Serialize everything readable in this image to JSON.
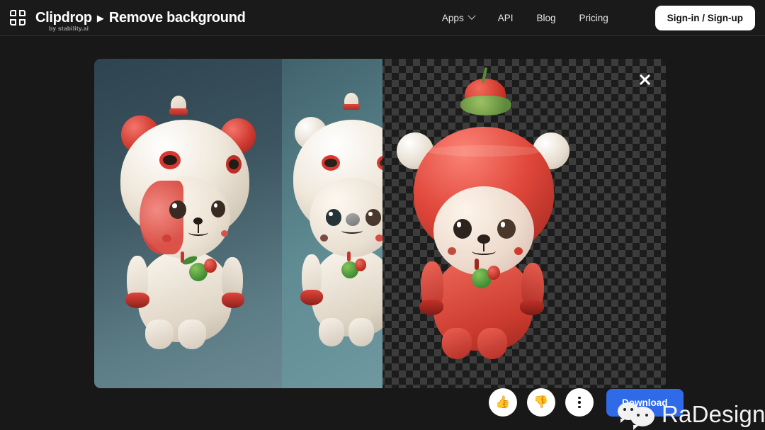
{
  "header": {
    "logo_icon": "crop-frame-icon",
    "brand_name": "Clipdrop",
    "brand_separator": "▶",
    "tool_name": "Remove background",
    "brand_subtitle": "by stability.ai",
    "nav": [
      {
        "label": "Apps",
        "has_chevron": true,
        "icon": "chevron-down-icon"
      },
      {
        "label": "API",
        "has_chevron": false
      },
      {
        "label": "Blog",
        "has_chevron": false
      },
      {
        "label": "Pricing",
        "has_chevron": false
      }
    ],
    "signin_label": "Sign-in / Sign-up"
  },
  "viewer": {
    "close_icon": "close-icon",
    "panels": [
      {
        "name": "original-image",
        "background": "#3c5560"
      },
      {
        "name": "comparison-strip",
        "background": "#5f8b93"
      },
      {
        "name": "transparent-result",
        "background": "checkerboard"
      }
    ],
    "checkerboard_colors": {
      "light": "#3c3c3c",
      "dark": "#1c1c1c"
    }
  },
  "actions": {
    "thumbs_up_icon": "👍",
    "thumbs_down_icon": "👎",
    "more_icon": "more-vertical-icon",
    "download_label": "Download",
    "download_color": "#2f6ae8"
  },
  "watermark": {
    "logo_icon": "wechat-icon",
    "text": "RaDesign"
  },
  "colors": {
    "page_background": "#181818",
    "header_background": "#1a1a1a",
    "accent_blue": "#2f6ae8",
    "text_primary": "#ffffff"
  }
}
